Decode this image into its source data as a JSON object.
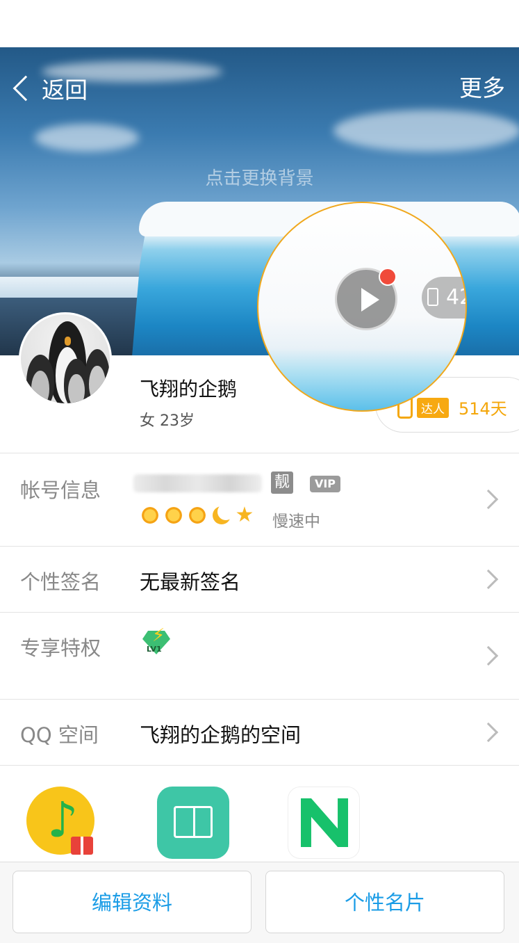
{
  "header": {
    "back_label": "返回",
    "more_label": "更多",
    "change_background_hint": "点击更换背景"
  },
  "profile": {
    "nickname": "飞翔的企鹅",
    "gender_age": "女 23岁",
    "daren_label": "达人",
    "daren_days": "514天",
    "like_count": "42"
  },
  "rows": {
    "account": {
      "label": "帐号信息",
      "liang_badge": "靓",
      "vip_badge": "VIP",
      "speed_status": "慢速中"
    },
    "signature": {
      "label": "个性签名",
      "value": "无最新签名"
    },
    "privilege": {
      "label": "专享特权",
      "level_badge": "LV1"
    },
    "qzone": {
      "label": "QQ 空间",
      "value": "飞翔的企鹅的空间"
    }
  },
  "apps": [
    "qq-music-icon",
    "reader-book-icon",
    "video-play-icon"
  ],
  "bottom": {
    "edit_profile": "编辑资料",
    "personal_card": "个性名片"
  },
  "colors": {
    "accent": "#1a9ce6",
    "daren": "#f4a70b",
    "magnifier_border": "#f0a81d"
  }
}
